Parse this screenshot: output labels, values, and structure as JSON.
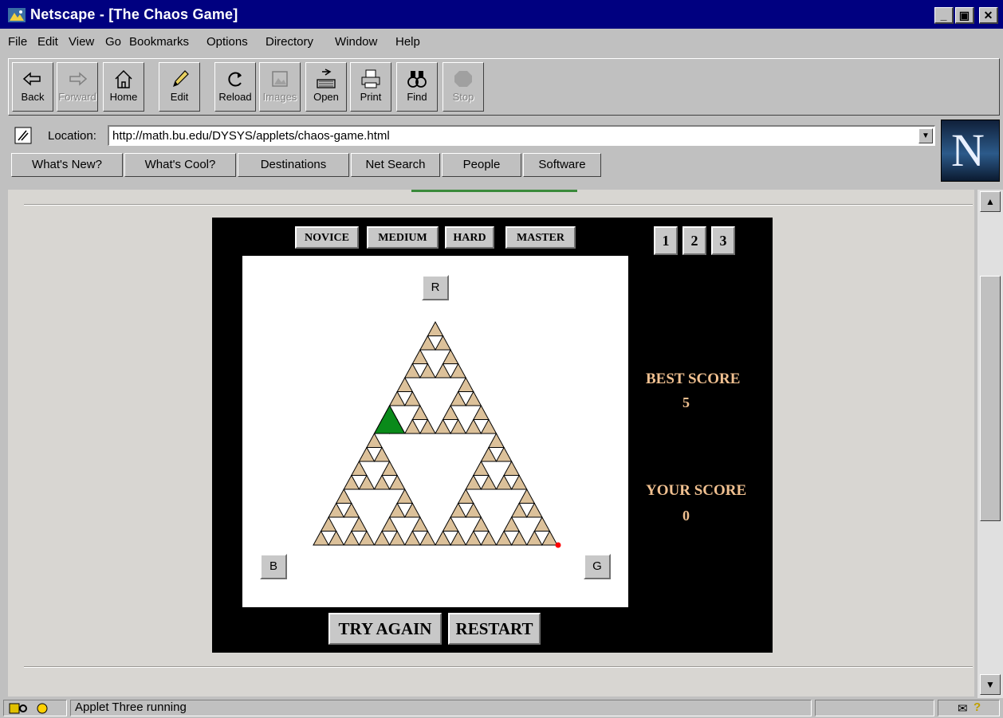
{
  "window": {
    "title": "Netscape - [The Chaos Game]",
    "controls": {
      "minimize": "_",
      "maximize": "▣",
      "close": "✕"
    }
  },
  "menu": [
    "File",
    "Edit",
    "View",
    "Go",
    "Bookmarks",
    "Options",
    "Directory",
    "Window",
    "Help"
  ],
  "toolbar": [
    {
      "label": "Back",
      "icon": "back-arrow-icon",
      "enabled": true
    },
    {
      "label": "Forward",
      "icon": "forward-arrow-icon",
      "enabled": false
    },
    {
      "label": "Home",
      "icon": "home-icon",
      "enabled": true
    },
    {
      "label": "Edit",
      "icon": "pencil-icon",
      "enabled": true
    },
    {
      "label": "Reload",
      "icon": "reload-icon",
      "enabled": true
    },
    {
      "label": "Images",
      "icon": "images-icon",
      "enabled": false
    },
    {
      "label": "Open",
      "icon": "open-icon",
      "enabled": true
    },
    {
      "label": "Print",
      "icon": "printer-icon",
      "enabled": true
    },
    {
      "label": "Find",
      "icon": "binoculars-icon",
      "enabled": true
    },
    {
      "label": "Stop",
      "icon": "stop-icon",
      "enabled": false
    }
  ],
  "location": {
    "label": "Location:",
    "url": "http://math.bu.edu/DYSYS/applets/chaos-game.html"
  },
  "directory_buttons": [
    "What's New?",
    "What's Cool?",
    "Destinations",
    "Net Search",
    "People",
    "Software"
  ],
  "applet": {
    "levels": [
      "NOVICE",
      "MEDIUM",
      "HARD",
      "MASTER"
    ],
    "games": [
      "1",
      "2",
      "3"
    ],
    "vertices": {
      "red": "R",
      "blue": "B",
      "green": "G"
    },
    "best_score_label": "BEST SCORE",
    "best_score": "5",
    "your_score_label": "YOUR SCORE",
    "your_score": "0",
    "try_again": "TRY AGAIN",
    "restart": "RESTART",
    "colors": {
      "tile": "#dcc19a",
      "target": "#0a8a1a",
      "point": "#ff0000",
      "score": "#f0c090"
    }
  },
  "status": {
    "text": "Applet Three running"
  }
}
